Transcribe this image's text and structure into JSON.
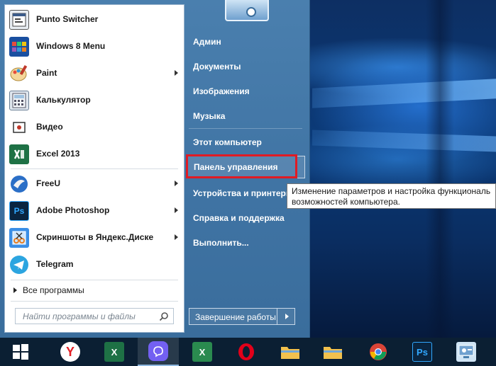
{
  "start_menu": {
    "programs": [
      {
        "label": "Punto Switcher",
        "icon": "punto-switcher-icon",
        "has_submenu": false
      },
      {
        "label": "Windows 8 Menu",
        "icon": "windows-8-menu-icon",
        "has_submenu": false
      },
      {
        "label": "Paint",
        "icon": "paint-icon",
        "has_submenu": true
      },
      {
        "label": "Калькулятор",
        "icon": "calculator-icon",
        "has_submenu": false
      },
      {
        "label": "Видео",
        "icon": "video-icon",
        "has_submenu": false
      },
      {
        "label": "Excel 2013",
        "icon": "excel-icon",
        "has_submenu": false
      },
      {
        "label": "FreeU",
        "icon": "freeu-icon",
        "has_submenu": true
      },
      {
        "label": "Adobe Photoshop",
        "icon": "photoshop-icon",
        "has_submenu": true
      },
      {
        "label": "Скриншоты в Яндекс.Диске",
        "icon": "yandex-disk-screenshots-icon",
        "has_submenu": true
      },
      {
        "label": "Telegram",
        "icon": "telegram-icon",
        "has_submenu": false
      }
    ],
    "all_programs_label": "Все программы",
    "search_placeholder": "Найти программы и файлы",
    "right_items": [
      {
        "label": "Админ"
      },
      {
        "label": "Документы"
      },
      {
        "label": "Изображения"
      },
      {
        "label": "Музыка"
      },
      {
        "label": "Этот компьютер"
      },
      {
        "label": "Панель управления",
        "highlighted": true
      },
      {
        "label": "Устройства и принтеры"
      },
      {
        "label": "Справка и поддержка"
      },
      {
        "label": "Выполнить..."
      }
    ],
    "shutdown_label": "Завершение работы",
    "tooltip": {
      "line1": "Изменение параметров и настройка функциональ",
      "line2": "возможностей компьютера."
    }
  },
  "taskbar": {
    "buttons": [
      {
        "icon": "windows-start-icon"
      },
      {
        "icon": "yandex-browser-icon"
      },
      {
        "icon": "excel-icon"
      },
      {
        "icon": "viber-icon",
        "active": true
      },
      {
        "icon": "excel-2013-icon"
      },
      {
        "icon": "opera-icon"
      },
      {
        "icon": "file-explorer-icon"
      },
      {
        "icon": "file-explorer-icon"
      },
      {
        "icon": "chrome-icon"
      },
      {
        "icon": "photoshop-icon"
      },
      {
        "icon": "control-panel-icon"
      }
    ]
  },
  "colors": {
    "menu_blue": "#3f73a3",
    "highlight_red": "#e01b24",
    "taskbar": "#0b1f33"
  }
}
